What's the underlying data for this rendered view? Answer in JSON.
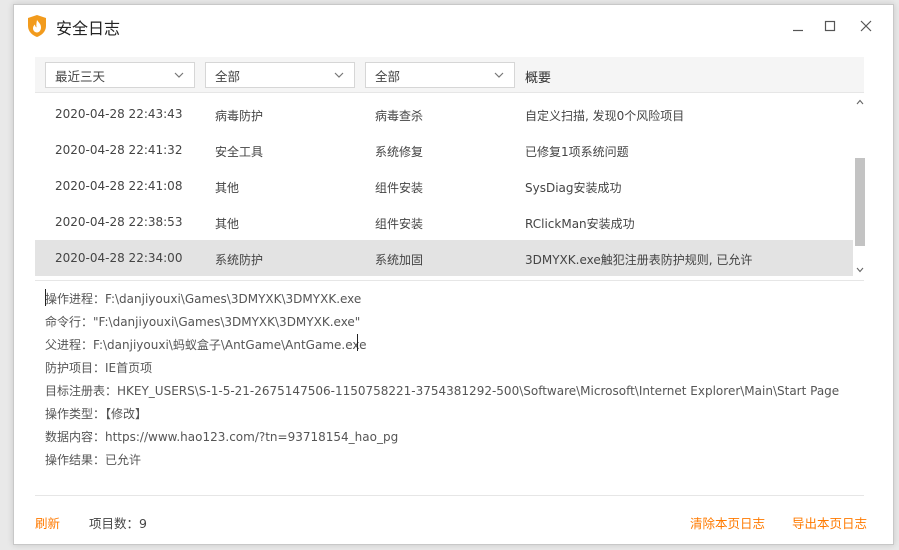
{
  "window": {
    "title": "安全日志"
  },
  "filters": {
    "time_range": "最近三天",
    "category": "全部",
    "type": "全部",
    "summary_header": "概要"
  },
  "log_rows": [
    {
      "time": "2020-04-28 22:43:43",
      "category": "病毒防护",
      "type": "病毒查杀",
      "summary": "自定义扫描, 发现0个风险项目"
    },
    {
      "time": "2020-04-28 22:41:32",
      "category": "安全工具",
      "type": "系统修复",
      "summary": "已修复1项系统问题"
    },
    {
      "time": "2020-04-28 22:41:08",
      "category": "其他",
      "type": "组件安装",
      "summary": "SysDiag安装成功"
    },
    {
      "time": "2020-04-28 22:38:53",
      "category": "其他",
      "type": "组件安装",
      "summary": "RClickMan安装成功"
    },
    {
      "time": "2020-04-28 22:34:00",
      "category": "系统防护",
      "type": "系统加固",
      "summary": "3DMYXK.exe触犯注册表防护规则, 已允许"
    }
  ],
  "selected_row": 4,
  "details": [
    "操作进程：F:\\danjiyouxi\\Games\\3DMYXK\\3DMYXK.exe",
    "命令行：\"F:\\danjiyouxi\\Games\\3DMYXK\\3DMYXK.exe\"",
    "父进程：F:\\danjiyouxi\\蚂蚁盒子\\AntGame\\AntGame.exe",
    "防护项目：IE首页项",
    "目标注册表：HKEY_USERS\\S-1-5-21-2675147506-1150758221-3754381292-500\\Software\\Microsoft\\Internet Explorer\\Main\\Start Page",
    "操作类型：【修改】",
    "数据内容：https://www.hao123.com/?tn=93718154_hao_pg",
    "操作结果：已允许"
  ],
  "footer": {
    "refresh": "刷新",
    "item_count": "项目数：9",
    "clear_page_log": "清除本页日志",
    "export_page_log": "导出本页日志"
  },
  "colors": {
    "accent": "#ff7a00",
    "logo": "#f29b1d",
    "selected_row_bg": "#e3e3e3"
  },
  "icons": {
    "logo": "shield-flame-icon",
    "minimize": "minimize-icon",
    "maximize": "maximize-icon",
    "close": "close-icon",
    "dropdown": "chevron-down-icon",
    "scroll_up": "chevron-up-icon",
    "scroll_down": "chevron-down-icon"
  }
}
